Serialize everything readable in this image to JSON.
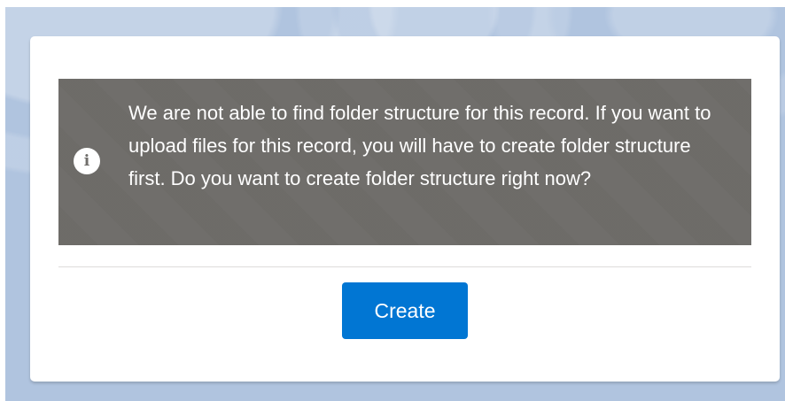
{
  "alert": {
    "icon": "info-icon",
    "icon_glyph": "i",
    "message": "We are not able to find folder structure for this record. If you want to upload files for this record, you will have to create folder structure first. Do you want to create folder structure right now?"
  },
  "actions": {
    "create_label": "Create"
  },
  "colors": {
    "alert_background": "#706e6b",
    "button_background": "#0176d3",
    "page_background": "#b0c4df",
    "card_background": "#ffffff"
  }
}
